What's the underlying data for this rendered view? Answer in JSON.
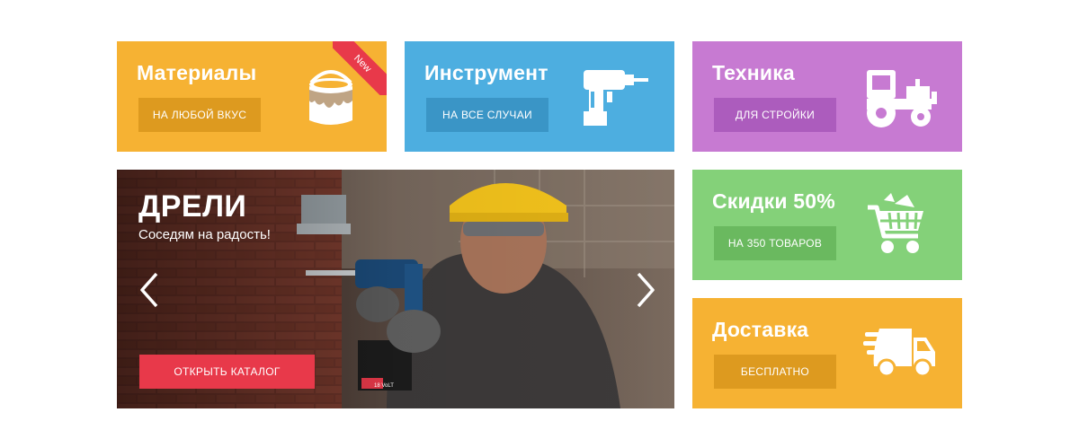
{
  "colors": {
    "orange": "#f6b233",
    "blue": "#4daee0",
    "purple": "#c77ad2",
    "green": "#84d179",
    "red": "#e8394a"
  },
  "tiles": {
    "materials": {
      "title": "Материалы",
      "button": "НА ЛЮБОЙ ВКУС",
      "ribbon": "New",
      "icon": "paint-can-icon"
    },
    "tools": {
      "title": "Инструмент",
      "button": "НА ВСЕ СЛУЧАИ",
      "icon": "drill-icon"
    },
    "machinery": {
      "title": "Техника",
      "button": "ДЛЯ СТРОЙКИ",
      "icon": "tractor-icon"
    },
    "discounts": {
      "title": "Скидки 50%",
      "button": "НА 350 ТОВАРОВ",
      "icon": "shopping-cart-icon"
    },
    "delivery": {
      "title": "Доставка",
      "button": "БЕСПЛАТНО",
      "icon": "delivery-truck-icon"
    }
  },
  "hero": {
    "title": "ДРЕЛИ",
    "subtitle": "Соседям на радость!",
    "button": "ОТКРЫТЬ КАТАЛОГ",
    "battery_label": "18 VoLT"
  }
}
